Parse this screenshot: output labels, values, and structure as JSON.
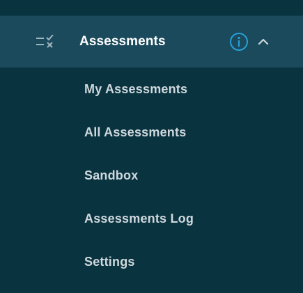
{
  "section": {
    "title": "Assessments",
    "icon": "checklist-icon",
    "info_icon": "info-icon",
    "toggle_icon": "chevron-up-icon",
    "expanded": true
  },
  "menu": {
    "items": [
      {
        "label": "My Assessments"
      },
      {
        "label": "All Assessments"
      },
      {
        "label": "Sandbox"
      },
      {
        "label": "Assessments Log"
      },
      {
        "label": "Settings"
      }
    ]
  },
  "colors": {
    "background": "#0a3340",
    "header_background": "#1a4a5c",
    "accent": "#2a9fd6",
    "text_primary": "#ffffff",
    "text_secondary": "#cfd9dd"
  }
}
